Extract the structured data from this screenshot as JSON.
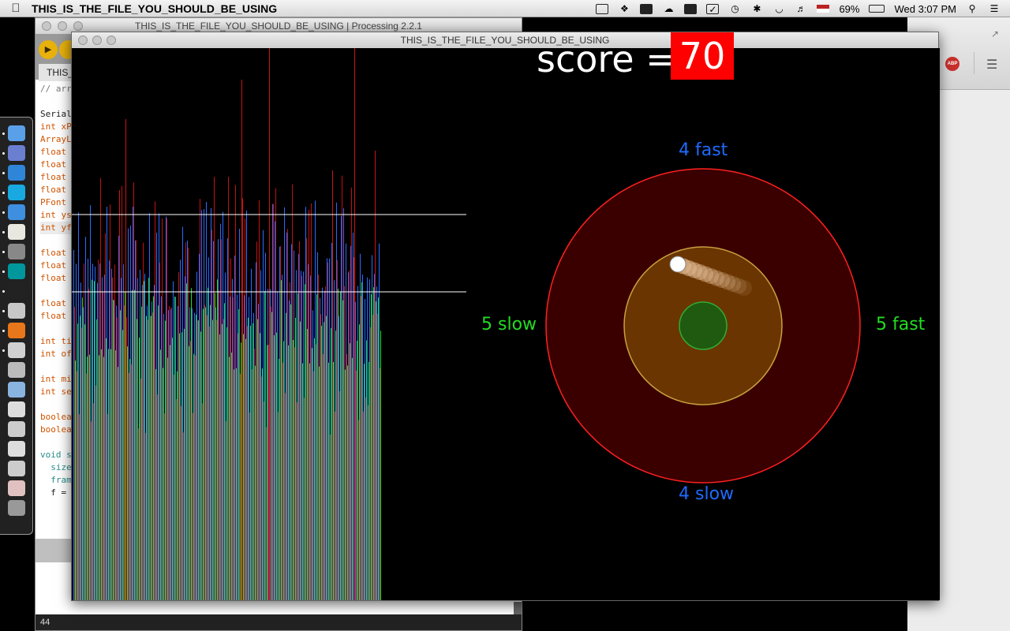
{
  "menubar": {
    "app_name": "THIS_IS_THE_FILE_YOU_SHOULD_BE_USING",
    "battery": "69%",
    "clock": "Wed 3:07 PM"
  },
  "editor": {
    "title": "THIS_IS_THE_FILE_YOU_SHOULD_BE_USING | Processing 2.2.1",
    "tab": "THIS_",
    "console_line": "44",
    "code_lines": [
      {
        "t": "// arr",
        "c": "c-gray"
      },
      {
        "t": "",
        "c": "c-black"
      },
      {
        "t": "Serial",
        "c": "c-black"
      },
      {
        "t": "int xP",
        "c": "c-orange"
      },
      {
        "t": "ArrayL",
        "c": "c-orange"
      },
      {
        "t": "float ",
        "c": "c-orange"
      },
      {
        "t": "float ",
        "c": "c-orange"
      },
      {
        "t": "float ",
        "c": "c-orange"
      },
      {
        "t": "float ",
        "c": "c-orange"
      },
      {
        "t": "PFont ",
        "c": "c-orange"
      },
      {
        "t": "int ys",
        "c": "c-orange"
      },
      {
        "t": "int yf",
        "c": "c-orange hl"
      },
      {
        "t": "",
        "c": "c-black"
      },
      {
        "t": "float ",
        "c": "c-orange"
      },
      {
        "t": "float ",
        "c": "c-orange"
      },
      {
        "t": "float ",
        "c": "c-orange"
      },
      {
        "t": "",
        "c": "c-black"
      },
      {
        "t": "float ",
        "c": "c-orange"
      },
      {
        "t": "float ",
        "c": "c-orange"
      },
      {
        "t": "",
        "c": "c-black"
      },
      {
        "t": "int ti",
        "c": "c-orange"
      },
      {
        "t": "int of",
        "c": "c-orange"
      },
      {
        "t": "",
        "c": "c-black"
      },
      {
        "t": "int mi",
        "c": "c-orange"
      },
      {
        "t": "int se",
        "c": "c-orange"
      },
      {
        "t": "",
        "c": "c-black"
      },
      {
        "t": "boolea",
        "c": "c-orange"
      },
      {
        "t": "boolea",
        "c": "c-orange"
      },
      {
        "t": "",
        "c": "c-black"
      },
      {
        "t": "void s",
        "c": "c-teal"
      },
      {
        "t": "  size",
        "c": "c-teal"
      },
      {
        "t": "  fram",
        "c": "c-teal"
      },
      {
        "t": "  f = ",
        "c": "c-black"
      }
    ]
  },
  "sketch": {
    "title": "THIS_IS_THE_FILE_YOU_SHOULD_BE_USING",
    "score_label": "score =",
    "score_value": "70",
    "labels": {
      "top": "4 fast",
      "bottom": "4 slow",
      "left": "5 slow",
      "right": "5 fast"
    },
    "colors": {
      "blue_label": "#1e6bff",
      "green_label": "#22dd22",
      "outer_ring": "#ff2020",
      "middle_ring": "#c8a040",
      "inner_ring": "#33aa33",
      "score_bg": "#ff0000"
    }
  },
  "dock_icons": [
    "finder-icon",
    "preview-icon",
    "safari-icon",
    "skype-icon",
    "itunes-icon",
    "textedit-icon",
    "system-prefs-icon",
    "arduino-icon",
    "processing-icon",
    "photos-icon",
    "firefox-icon",
    "java-icon",
    "app-icon-1",
    "folder-icon",
    "dvd-icon",
    "app-icon-2",
    "app-icon-3",
    "app-icon-4",
    "app-icon-5",
    "trash-icon"
  ]
}
